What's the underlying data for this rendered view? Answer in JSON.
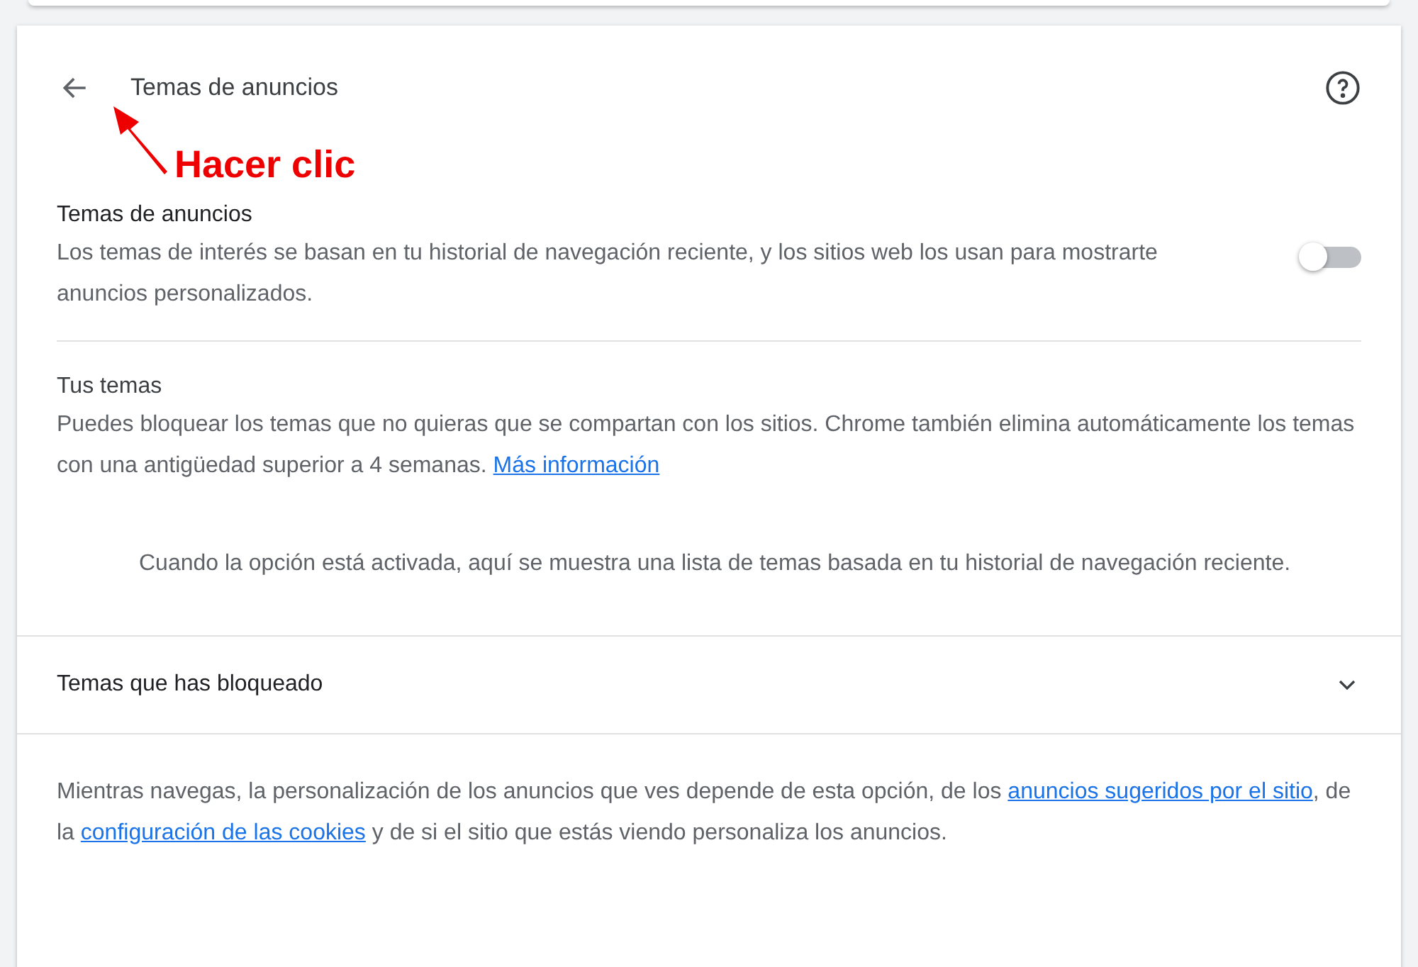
{
  "header": {
    "title": "Temas de anuncios"
  },
  "annotation": {
    "label": "Hacer clic"
  },
  "toggle_row": {
    "title": "Temas de anuncios",
    "description": "Los temas de interés se basan en tu historial de navegación reciente, y los sitios web los usan para mostrarte anuncios personalizados.",
    "on": false
  },
  "your_topics": {
    "title": "Tus temas",
    "description": "Puedes bloquear los temas que no quieras que se compartan con los sitios. Chrome también elimina automáticamente los temas con una antigüedad superior a 4 semanas.",
    "link": "Más información",
    "empty_message": "Cuando la opción está activada, aquí se muestra una lista de temas basada en tu historial de navegación reciente."
  },
  "blocked": {
    "title": "Temas que has bloqueado",
    "expanded": false
  },
  "footer": [
    {
      "kind": "text",
      "text": "Mientras navegas, la personalización de los anuncios que ves depende de esta opción, de los "
    },
    {
      "kind": "link",
      "text": "anuncios sugeridos por el sitio"
    },
    {
      "kind": "text",
      "text": ", de la "
    },
    {
      "kind": "link",
      "text": "configuración de las cookies"
    },
    {
      "kind": "text",
      "text": " y de si el sitio que estás viendo personaliza los anuncios."
    }
  ]
}
